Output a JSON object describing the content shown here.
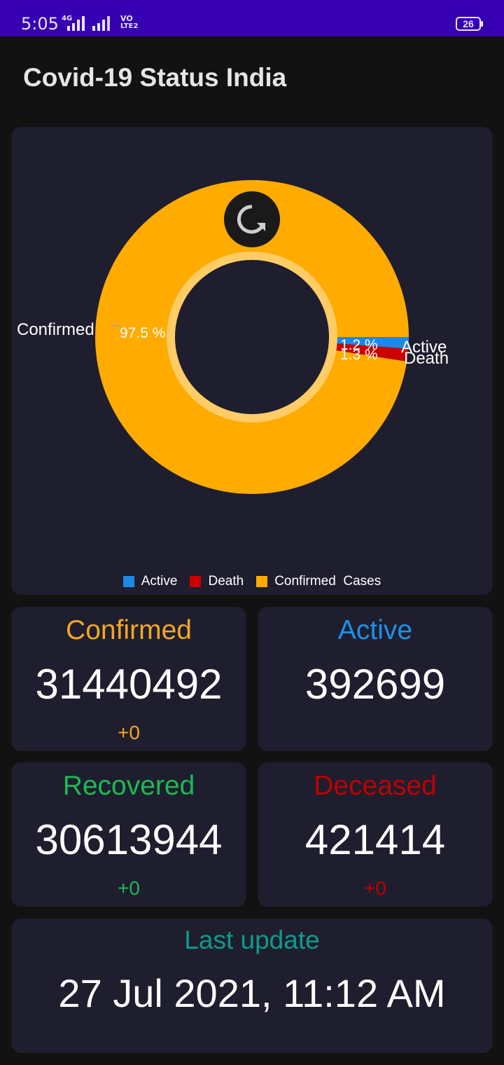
{
  "status_bar": {
    "time": "5:05",
    "network_primary": "4G",
    "volte_top": "VO",
    "volte_bottom": "LTE2",
    "battery": "26"
  },
  "app": {
    "title": "Covid-19 Status India"
  },
  "chart": {
    "legend": [
      {
        "label": "Active",
        "color": "#1e88e5"
      },
      {
        "label": "Death",
        "color": "#cc0000"
      },
      {
        "label": "Confirmed  Cases",
        "color": "#ffab00"
      }
    ],
    "refresh_icon": "refresh-icon"
  },
  "chart_data": {
    "type": "pie",
    "style": "donut",
    "slices": [
      {
        "label": "Confirmed",
        "value": 97.5,
        "value_label": "97.5 %",
        "color": "#ffab00"
      },
      {
        "label": "Active",
        "value": 1.2,
        "value_label": "1.2 %",
        "color": "#1e88e5"
      },
      {
        "label": "Death",
        "value": 1.3,
        "value_label": "1.3 %",
        "color": "#cc0000"
      }
    ],
    "legend_position": "bottom-center"
  },
  "stats": {
    "confirmed": {
      "label": "Confirmed",
      "value": "31440492",
      "delta": "+0",
      "color": "#f5a623"
    },
    "active": {
      "label": "Active",
      "value": "392699",
      "delta": "",
      "color": "#1e90e6"
    },
    "recovered": {
      "label": "Recovered",
      "value": "30613944",
      "delta": "+0",
      "color": "#1db954"
    },
    "deceased": {
      "label": "Deceased",
      "value": "421414",
      "delta": "+0",
      "color": "#c00000"
    }
  },
  "last_update": {
    "label": "Last update",
    "value": "27 Jul 2021, 11:12 AM",
    "label_color": "#0f9a8c"
  }
}
